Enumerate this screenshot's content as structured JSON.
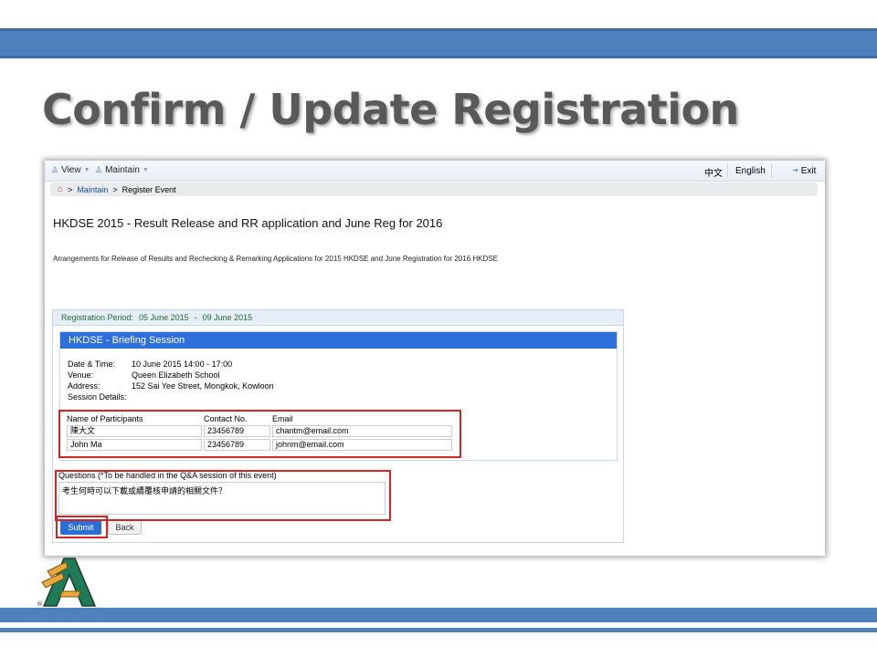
{
  "slide": {
    "title": "Confirm / Update Registration",
    "colors": {
      "band": "#4f81bd",
      "title_text": "#595959",
      "highlight": "#d62424"
    }
  },
  "nav": {
    "menu": [
      {
        "label": "View",
        "icon": "user-icon"
      },
      {
        "label": "Maintain",
        "icon": "user-icon"
      }
    ],
    "lang_chinese": "中文",
    "lang_english": "English",
    "exit_label": "Exit"
  },
  "breadcrumb": {
    "sep1": ">",
    "link": "Maintain",
    "sep2": ">",
    "current": "Register Event"
  },
  "event": {
    "title": "HKDSE 2015 - Result Release and RR application and June Reg for 2016",
    "description": "Arrangements for Release of Results and Rechecking & Remarking Applications for 2015 HKDSE and June Registration for 2016 HKDSE"
  },
  "registration": {
    "period_label": "Registration Period:",
    "start": "05 June 2015",
    "dash": "-",
    "end": "09 June 2015"
  },
  "session": {
    "title": "HKDSE - Briefing Session",
    "date_label": "Date & Time:",
    "date_value": "10 June 2015  14:00 - 17:00",
    "venue_label": "Venue:",
    "venue_value": "Queen Elizabeth School",
    "address_label": "Address:",
    "address_value": "152 Sai Yee Street, Mongkok, Kowloon",
    "details_label": "Session Details:"
  },
  "participants": {
    "headers": [
      "Name of Participants",
      "Contact No.",
      "Email"
    ],
    "rows": [
      {
        "name": "陳大文",
        "contact": "23456789",
        "email": "chantm@email.com"
      },
      {
        "name": "John Ma",
        "contact": "23456789",
        "email": "johnm@email.com"
      }
    ]
  },
  "questions": {
    "label": "Questions (*To be handled in the Q&A session of this event)",
    "value": "考生何時可以下載或續覆核申請的相關文件？"
  },
  "buttons": {
    "submit": "Submit",
    "back": "Back"
  }
}
